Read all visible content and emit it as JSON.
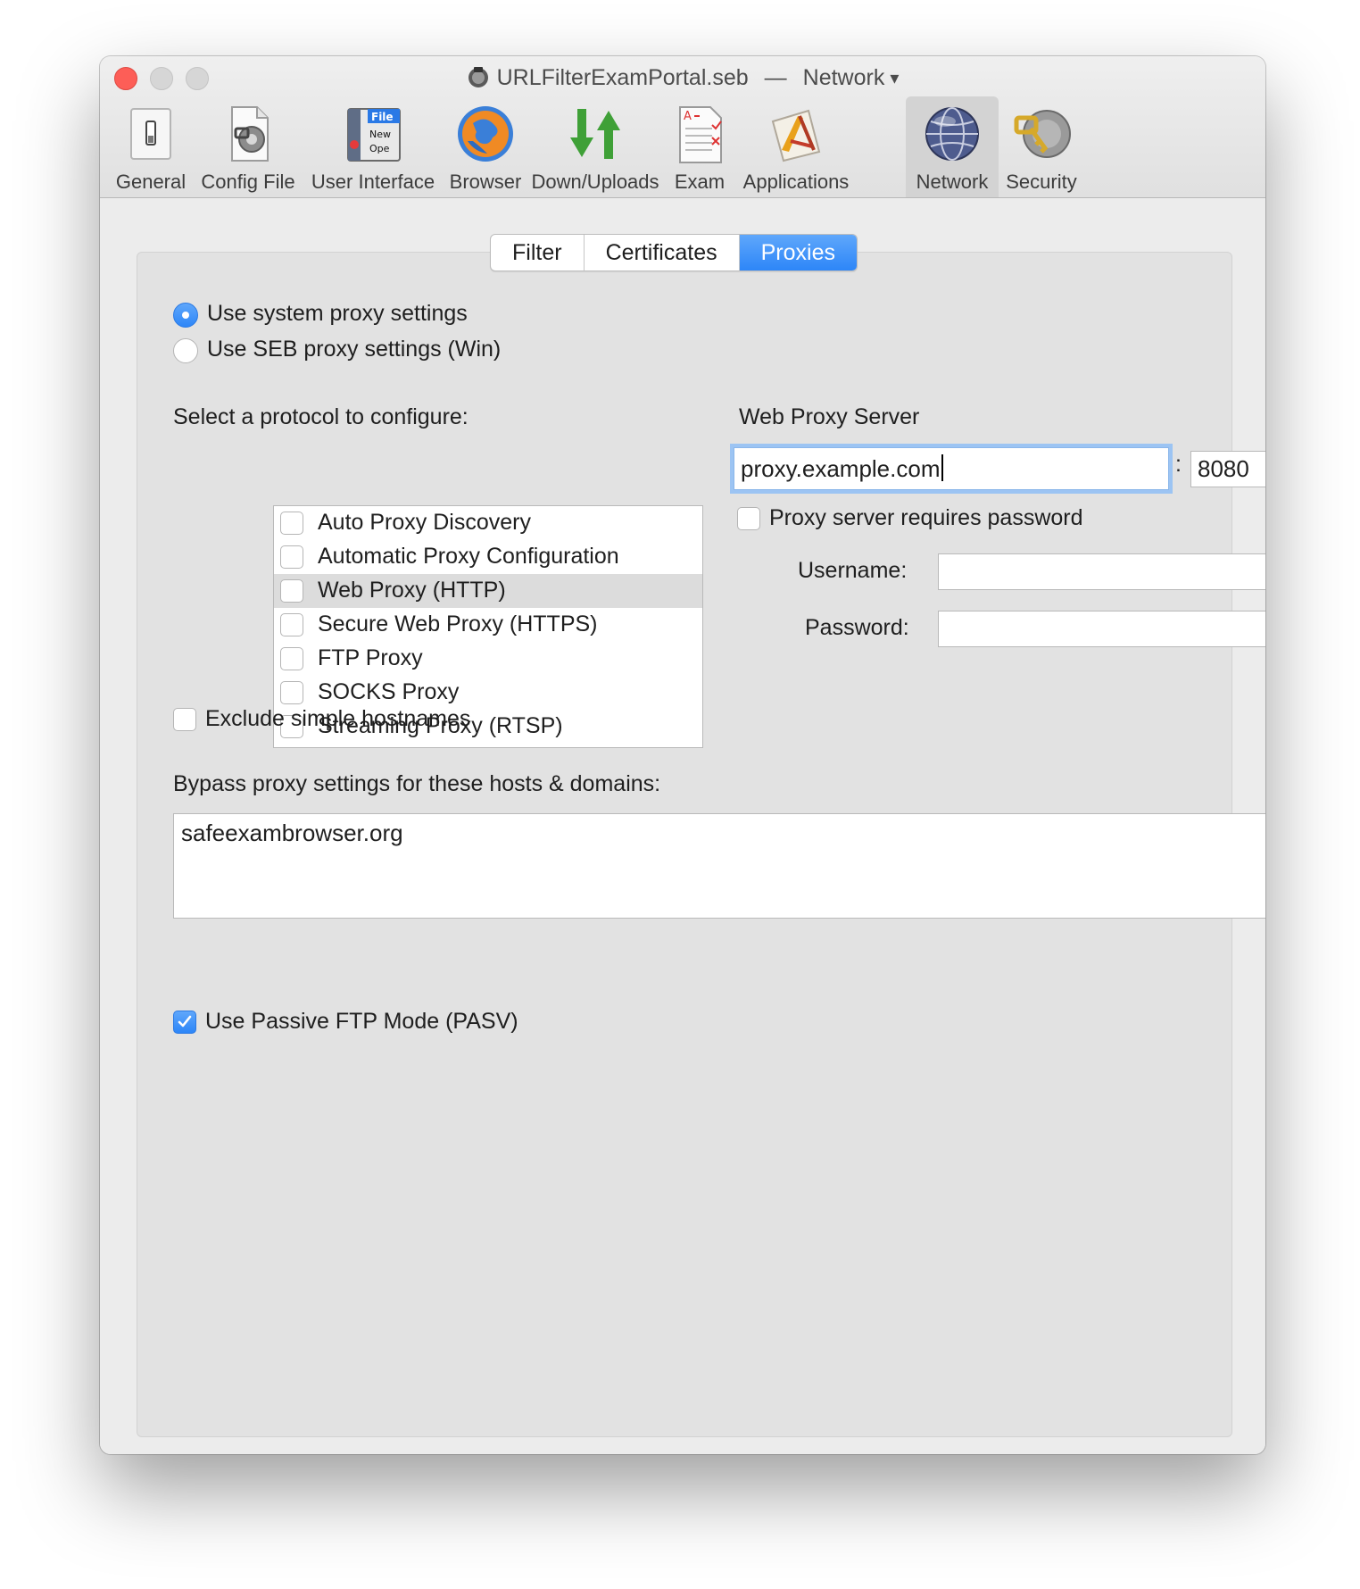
{
  "window": {
    "title": "URLFilterExamPortal.seb",
    "separator": "—",
    "subtitle": "Network",
    "subtitle_caret": "▾"
  },
  "toolbar": {
    "items": [
      {
        "label": "General",
        "icon": "general-switch-icon"
      },
      {
        "label": "Config File",
        "icon": "config-file-icon"
      },
      {
        "label": "User Interface",
        "icon": "user-interface-icon"
      },
      {
        "label": "Browser",
        "icon": "browser-globe-icon"
      },
      {
        "label": "Down/Uploads",
        "icon": "down-uploads-arrows-icon"
      },
      {
        "label": "Exam",
        "icon": "exam-sheet-icon"
      },
      {
        "label": "Applications",
        "icon": "applications-icon"
      },
      {
        "label": "Network",
        "icon": "network-globe-icon",
        "selected": true
      },
      {
        "label": "Security",
        "icon": "security-keys-icon"
      }
    ],
    "ui_icon_text": {
      "file": "File",
      "new": "New",
      "open": "Ope"
    }
  },
  "tabs": {
    "items": [
      "Filter",
      "Certificates",
      "Proxies"
    ],
    "active": "Proxies"
  },
  "proxy_mode": {
    "options": [
      {
        "label": "Use system proxy settings",
        "selected": true
      },
      {
        "label": "Use SEB proxy settings (Win)",
        "selected": false
      }
    ]
  },
  "protocols": {
    "heading": "Select a protocol to configure:",
    "items": [
      {
        "label": "Auto Proxy Discovery",
        "checked": false
      },
      {
        "label": "Automatic Proxy Configuration",
        "checked": false
      },
      {
        "label": "Web Proxy (HTTP)",
        "checked": false,
        "highlighted": true
      },
      {
        "label": "Secure Web Proxy (HTTPS)",
        "checked": false
      },
      {
        "label": "FTP Proxy",
        "checked": false
      },
      {
        "label": "SOCKS Proxy",
        "checked": false
      },
      {
        "label": "Streaming Proxy (RTSP)",
        "checked": false
      }
    ]
  },
  "server": {
    "heading": "Web Proxy Server",
    "host": "proxy.example.com",
    "colon": ":",
    "port": "8080",
    "requires_password_label": "Proxy server requires password",
    "requires_password": false,
    "username_label": "Username:",
    "username": "",
    "password_label": "Password:",
    "password": ""
  },
  "exclude_simple": {
    "label": "Exclude simple hostnames",
    "checked": false
  },
  "bypass": {
    "label": "Bypass proxy settings for these hosts & domains:",
    "value": "safeexambrowser.org"
  },
  "passive_ftp": {
    "label": "Use Passive FTP Mode (PASV)",
    "checked": true
  },
  "colors": {
    "accent": "#2d86f8",
    "close_button": "#fd5e57",
    "window_bg": "#ececec",
    "group_bg": "#e2e2e2"
  }
}
